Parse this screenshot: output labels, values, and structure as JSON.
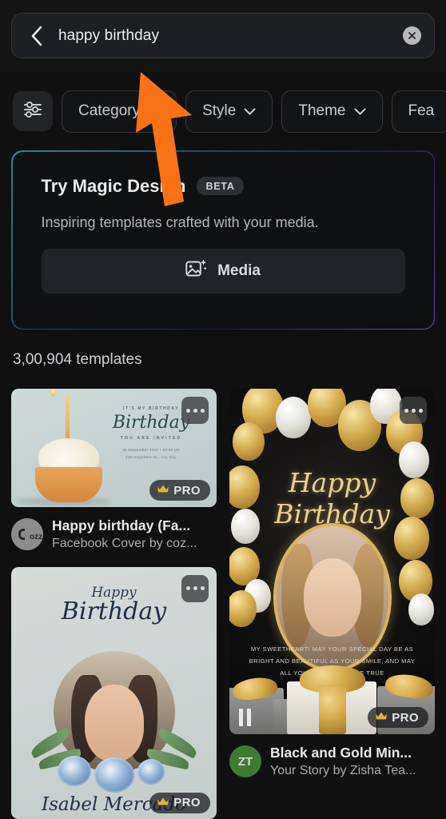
{
  "search": {
    "value": "happy birthday",
    "back_icon": "chevron-left-icon",
    "clear_icon": "close-circle-icon"
  },
  "filters": {
    "icon": "sliders-icon",
    "chips": [
      {
        "label": "Category",
        "has_chevron": true
      },
      {
        "label": "Style",
        "has_chevron": true
      },
      {
        "label": "Theme",
        "has_chevron": true
      },
      {
        "label": "Fea",
        "has_chevron": false
      }
    ]
  },
  "magic": {
    "title": "Try Magic Design",
    "badge": "BETA",
    "subtitle": "Inspiring templates crafted with your media.",
    "button_label": "Media",
    "button_icon": "image-sparkle-icon",
    "border_gradient_start": "#2e8296",
    "border_gradient_end": "#6b4bbd"
  },
  "results": {
    "count_label": "3,00,904 templates"
  },
  "templates": [
    {
      "title": "Happy birthday (Fa...",
      "subtitle": "Facebook Cover by coz...",
      "avatar_text": "cozz",
      "avatar_color": "#8c8c8c",
      "pro": true,
      "pro_label": "PRO",
      "video": false,
      "art": {
        "kicker": "IT'S MY BIRTHDAY",
        "script": "Birthday",
        "invited": "YOU ARE INVITED",
        "detail_line1": "26 September 2022  •  10:00 pm",
        "detail_line2": "123 Anywhere St., Any City"
      }
    },
    {
      "title": "",
      "subtitle": "",
      "pro": true,
      "pro_label": "PRO",
      "video": false,
      "art": {
        "script_small": "Happy",
        "script_large": "Birthday",
        "name": "Isabel Mercado"
      }
    },
    {
      "title": "Black and Gold Min...",
      "subtitle": "Your Story by Zisha Tea...",
      "avatar_text": "ZT",
      "avatar_color": "#3f7a30",
      "pro": true,
      "pro_label": "PRO",
      "video": true,
      "art": {
        "script": "Happy Birthday",
        "message": "MY SWEETHEART! MAY YOUR SPECIAL DAY BE AS BRIGHT AND BEAUTIFUL AS YOUR SMILE, AND MAY ALL YOUR DREAMS COME TRUE"
      }
    }
  ],
  "cursor": {
    "color": "#f97316"
  }
}
